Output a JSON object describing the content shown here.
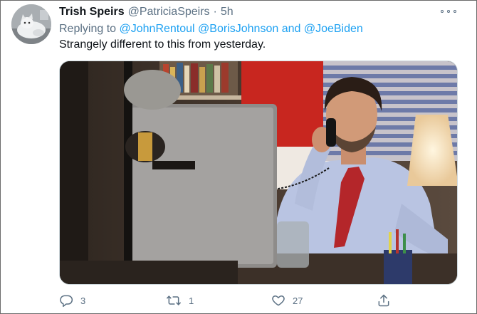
{
  "tweet": {
    "author": {
      "display_name": "Trish Speirs",
      "handle": "@PatriciaSpeirs",
      "separator": "·",
      "time": "5h",
      "avatar_icon": "cat-avatar-photo"
    },
    "more_icon": "more-horizontal-icon",
    "reply_context": {
      "prefix": "Replying to",
      "mentions": [
        "@JohnRentoul",
        "@BorisJohnson"
      ],
      "conjunction": "and",
      "last_mention": "@JoeBiden"
    },
    "text": "Strangely different to this from yesterday.",
    "media": {
      "type": "photo"
    },
    "actions": {
      "reply": {
        "icon": "reply-icon",
        "count": "3"
      },
      "retweet": {
        "icon": "retweet-icon",
        "count": "1"
      },
      "like": {
        "icon": "heart-icon",
        "count": "27"
      },
      "share": {
        "icon": "share-icon"
      }
    }
  },
  "colors": {
    "link": "#1da1f2",
    "secondary_text": "#5b7083",
    "primary_text": "#0f1419"
  }
}
